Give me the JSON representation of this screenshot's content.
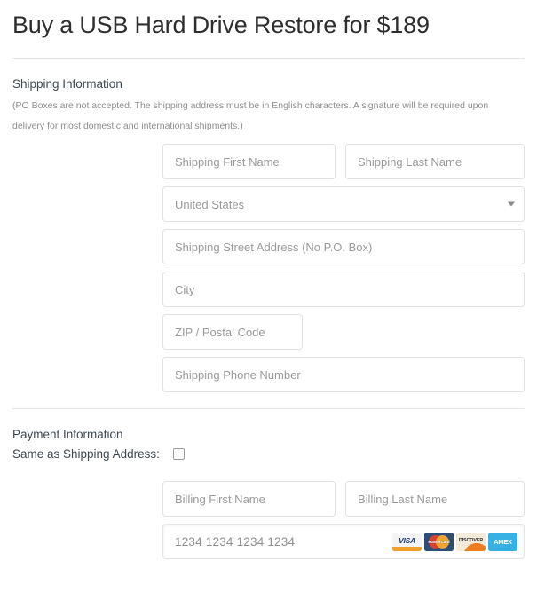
{
  "page": {
    "title": "Buy a USB Hard Drive Restore for $189"
  },
  "shipping": {
    "heading": "Shipping Information",
    "note": "(PO Boxes are not accepted. The shipping address must be in English characters. A signature will be required upon delivery for most domestic and international shipments.)",
    "first_name_placeholder": "Shipping First Name",
    "last_name_placeholder": "Shipping Last Name",
    "country_selected": "United States",
    "country_caret_icon": "chevron-down-icon",
    "street_placeholder": "Shipping Street Address (No P.O. Box)",
    "city_placeholder": "City",
    "zip_placeholder": "ZIP / Postal Code",
    "phone_placeholder": "Shipping Phone Number"
  },
  "payment": {
    "heading": "Payment Information",
    "same_as_shipping_label": "Same as Shipping Address:",
    "same_as_shipping_checked": false,
    "billing_first_name_placeholder": "Billing First Name",
    "billing_last_name_placeholder": "Billing Last Name",
    "card_number_placeholder": "1234 1234 1234 1234",
    "card_brands": [
      {
        "name": "VISA",
        "icon": "visa-card-icon",
        "color": "#1a3a78"
      },
      {
        "name": "MasterCard",
        "icon": "mastercard-card-icon",
        "color": "#2b4d78"
      },
      {
        "name": "DISCOVER",
        "icon": "discover-card-icon",
        "color": "#ef7c20"
      },
      {
        "name": "AMEX",
        "icon": "amex-card-icon",
        "color": "#37b0e4"
      }
    ]
  },
  "theme": {
    "text_dark": "#2e2e2e",
    "heading_color": "#3d4852",
    "placeholder_color": "#9a9a9a",
    "border_color": "#e2e2e2",
    "divider_color": "#e6e6e6"
  }
}
